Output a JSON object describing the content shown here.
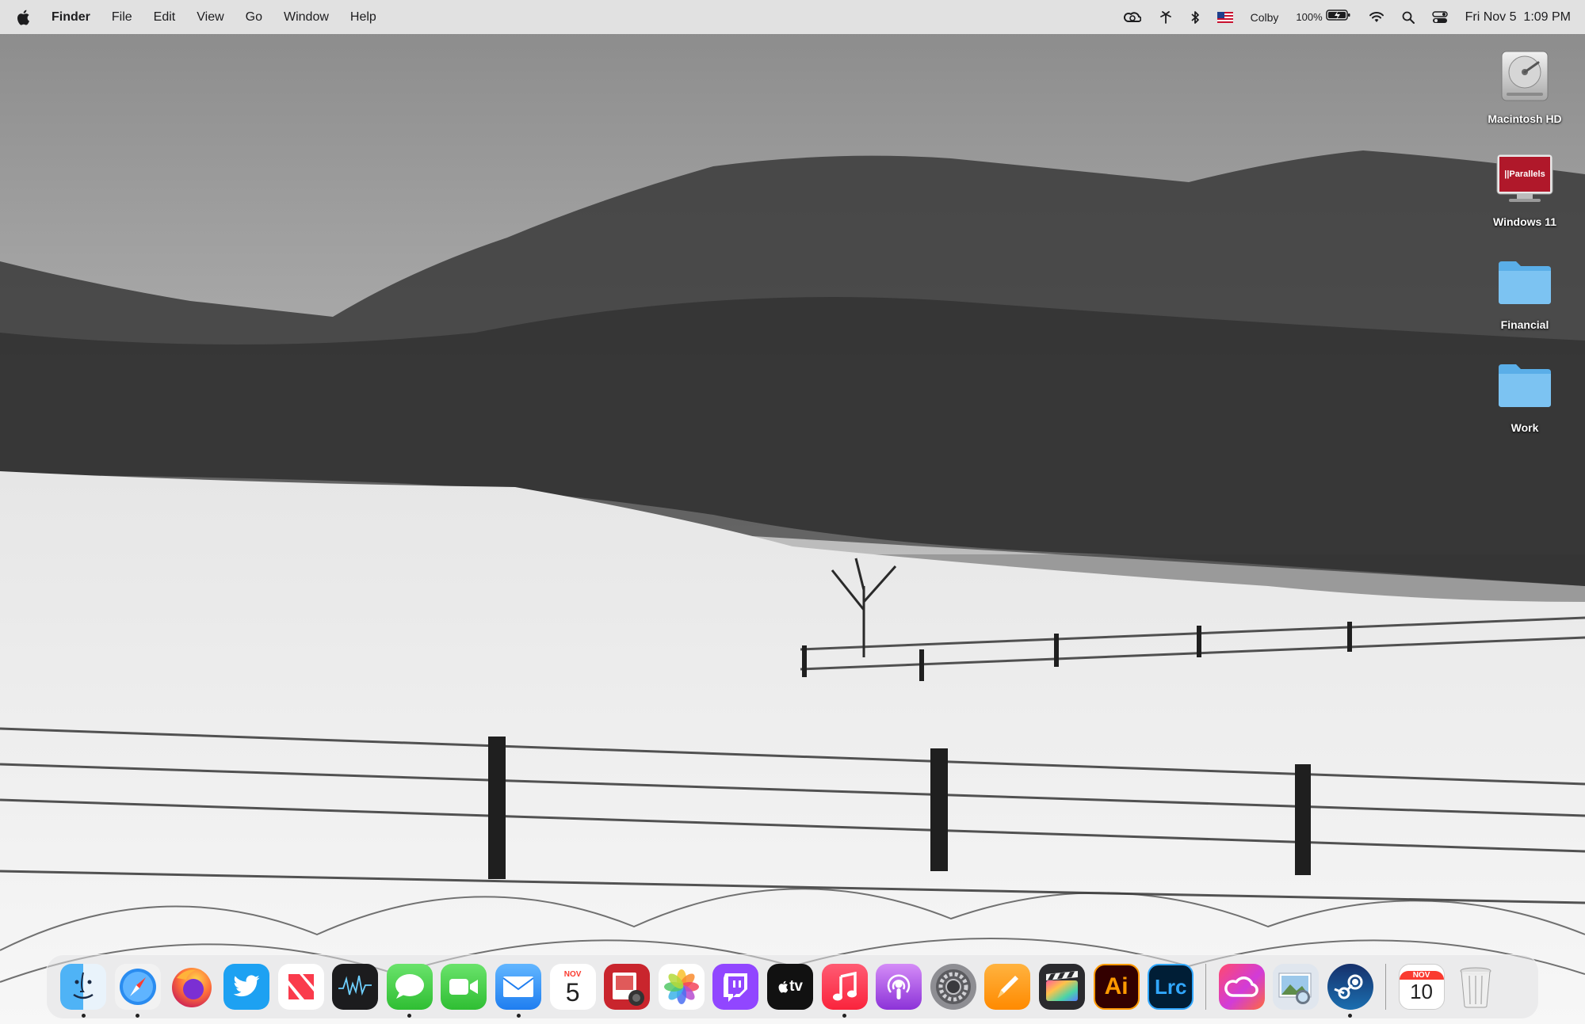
{
  "menubar": {
    "app_name": "Finder",
    "menus": [
      "File",
      "Edit",
      "View",
      "Go",
      "Window",
      "Help"
    ],
    "status": {
      "user": "Colby",
      "battery_pct": "100%",
      "datetime": "Fri Nov 5  1:09 PM"
    }
  },
  "desktop": {
    "icons": [
      {
        "label": "Macintosh HD",
        "icon": "hard-drive-icon"
      },
      {
        "label": "Windows 11",
        "icon": "parallels-vm-icon",
        "badge": "||Parallels"
      },
      {
        "label": "Financial",
        "icon": "folder-icon"
      },
      {
        "label": "Work",
        "icon": "folder-icon"
      }
    ]
  },
  "dock": {
    "apps": [
      {
        "name": "Finder",
        "running": true
      },
      {
        "name": "Safari",
        "running": true
      },
      {
        "name": "Firefox",
        "running": false
      },
      {
        "name": "Twitter",
        "running": false
      },
      {
        "name": "News",
        "running": false
      },
      {
        "name": "Activity Monitor",
        "running": false
      },
      {
        "name": "Messages",
        "running": true
      },
      {
        "name": "FaceTime",
        "running": false
      },
      {
        "name": "Mail",
        "running": true
      },
      {
        "name": "Calendar",
        "running": false,
        "month": "NOV",
        "day": "5"
      },
      {
        "name": "Photo Booth",
        "running": false
      },
      {
        "name": "Photos",
        "running": false
      },
      {
        "name": "Twitch",
        "running": false
      },
      {
        "name": "Apple TV",
        "running": false,
        "label": "tv"
      },
      {
        "name": "Music",
        "running": true
      },
      {
        "name": "Podcasts",
        "running": false
      },
      {
        "name": "System Preferences",
        "running": false
      },
      {
        "name": "Pages",
        "running": false
      },
      {
        "name": "Final Cut Pro",
        "running": false
      },
      {
        "name": "Adobe Illustrator",
        "running": false,
        "label": "Ai"
      },
      {
        "name": "Lightroom Classic",
        "running": false,
        "label": "Lrc"
      },
      {
        "name": "Creative Cloud",
        "running": false
      },
      {
        "name": "Preview",
        "running": false
      },
      {
        "name": "Steam",
        "running": true
      },
      {
        "name": "Calendar Document",
        "running": false,
        "month": "NOV",
        "day": "10"
      },
      {
        "name": "Trash",
        "running": false
      }
    ]
  }
}
